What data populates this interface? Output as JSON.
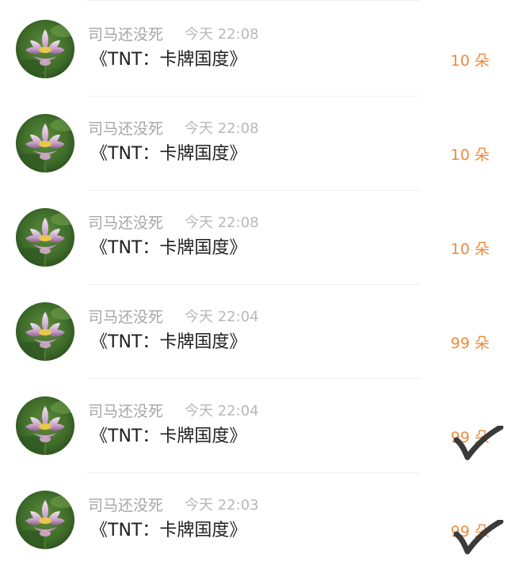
{
  "gifts": [
    {
      "username": "司马还没死",
      "time": "今天 22:08",
      "book": "《TNT：卡牌国度》",
      "amount": "10 朵",
      "marked": false
    },
    {
      "username": "司马还没死",
      "time": "今天 22:08",
      "book": "《TNT：卡牌国度》",
      "amount": "10 朵",
      "marked": false
    },
    {
      "username": "司马还没死",
      "time": "今天 22:08",
      "book": "《TNT：卡牌国度》",
      "amount": "10 朵",
      "marked": false
    },
    {
      "username": "司马还没死",
      "time": "今天 22:04",
      "book": "《TNT：卡牌国度》",
      "amount": "99 朵",
      "marked": false
    },
    {
      "username": "司马还没死",
      "time": "今天 22:04",
      "book": "《TNT：卡牌国度》",
      "amount": "99 朵",
      "marked": true
    },
    {
      "username": "司马还没死",
      "time": "今天 22:03",
      "book": "《TNT：卡牌国度》",
      "amount": "99 朵",
      "marked": true
    }
  ],
  "avatar_icon": "lotus-flower-icon",
  "check_icon": "handdrawn-checkmark-icon",
  "colors": {
    "username": "#a6a6a6",
    "time": "#b8b8b8",
    "book": "#1f1f1f",
    "amount": "#f08a3c",
    "divider": "#efefef",
    "checkmark": "#3a3a3a"
  }
}
